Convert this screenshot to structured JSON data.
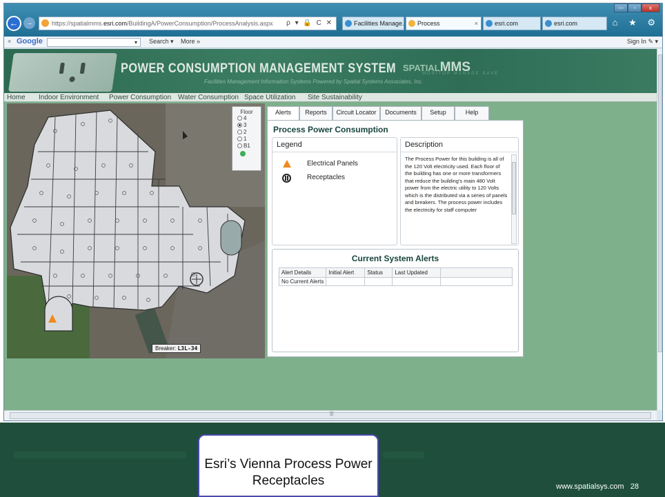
{
  "browser": {
    "url_prefix": "https://spatialmms.",
    "url_host": "esri.com",
    "url_path": "/BuildingA/PowerConsumption/ProcessAnalysis.aspx",
    "url_tools": "ρ ▾ 🔒 C ✕",
    "tabs": [
      {
        "label": "Facilities Manage...",
        "active": false
      },
      {
        "label": "Process",
        "active": true
      },
      {
        "label": "esri.com",
        "active": false
      },
      {
        "label": "esri.com",
        "active": false
      }
    ],
    "tab_close": "×",
    "nav_back": "←",
    "nav_forward": "→",
    "right_icons": "⌂ ★ ⚙",
    "window_buttons": {
      "minimize": "—",
      "maximize": "▫",
      "close": "x"
    }
  },
  "googlebar": {
    "close": "×",
    "logo": "Google",
    "search_value": "▾",
    "search_button": "Search ▾",
    "more": "More »",
    "sign_in": "Sign In ✎ ▾"
  },
  "banner": {
    "title": "POWER CONSUMPTION MANAGEMENT SYSTEM",
    "subtitle": "Facilities Management Information Systems   Powered by Spatial Systems Associates, Inc.",
    "logo_prefix": "SPATIAL",
    "logo_mark": "MMS",
    "logo_tagline": "MONITOR MANAGE SAVE"
  },
  "site_nav": [
    "Home",
    "Indoor Environment",
    "Power Consumption",
    "Water Consumption",
    "Space Utilization",
    "Site Sustainability"
  ],
  "floor_selector": {
    "title": "Floor",
    "options": [
      "4",
      "3",
      "2",
      "1",
      "B1"
    ],
    "selected": "3"
  },
  "map": {
    "breaker_prefix": "Breaker:",
    "breaker_value": "L3L-34"
  },
  "panel_tabs": [
    "Alerts",
    "Reports",
    "Circuit Locator",
    "Documents",
    "Setup",
    "Help"
  ],
  "panel": {
    "title": "Process Power Consumption",
    "legend_title": "Legend",
    "legend_items": [
      "Electrical Panels",
      "Receptacles"
    ],
    "description_title": "Description",
    "description_text": "The Process Power for this building is all of the 120 Volt electricity used.  Each floor of the building has one or more transformers that reduce the building's main 480 Volt power from the electric utility to 120 Volts which is the distributed via a series of panels and breakers. The process power includes the electricity for staff computer",
    "alerts_title": "Current System Alerts",
    "alerts_columns": [
      "Alert Details",
      "Initial Alert",
      "Status",
      "Last Updated",
      ""
    ],
    "alerts_rows": [
      [
        "No Current Alerts",
        "",
        "",
        "",
        ""
      ]
    ]
  },
  "slide": {
    "caption": "Esri’s Vienna Process Power Receptacles",
    "footer_url": "www.spatialsys.com",
    "page_number": "28"
  },
  "colors": {
    "page_background": "#7fb08c",
    "slide_footer": "#1f4f3c",
    "banner": "#2f6d56",
    "panel_heading": "#17443b",
    "electrical_panel_marker": "#f08a1c"
  }
}
